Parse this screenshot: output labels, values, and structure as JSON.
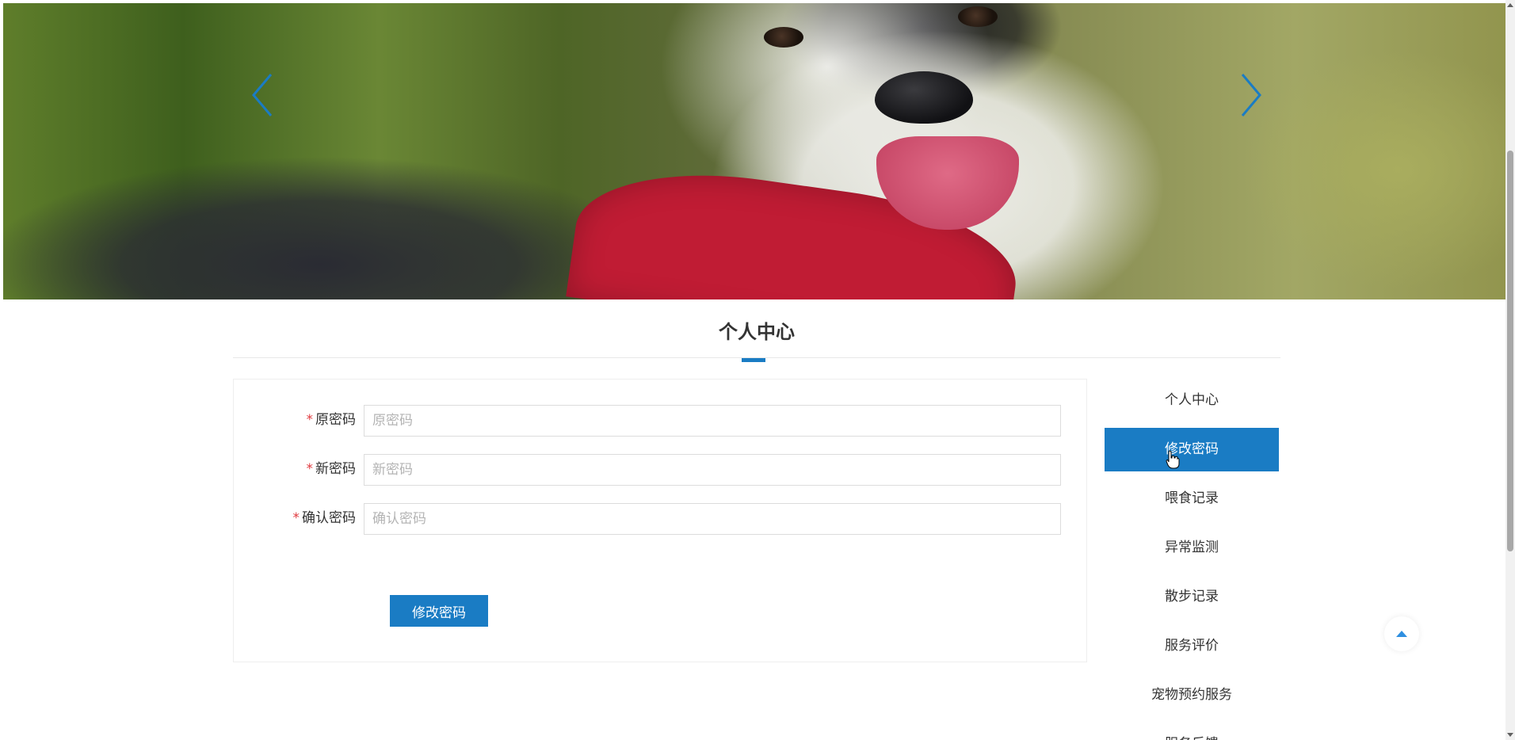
{
  "banner": {
    "prev_icon": "chevron-left-icon",
    "next_icon": "chevron-right-icon",
    "arrow_color": "#1a7cc4"
  },
  "section": {
    "title": "个人中心"
  },
  "form": {
    "fields": [
      {
        "label": "原密码",
        "required": "*",
        "placeholder": "原密码",
        "value": ""
      },
      {
        "label": "新密码",
        "required": "*",
        "placeholder": "新密码",
        "value": ""
      },
      {
        "label": "确认密码",
        "required": "*",
        "placeholder": "确认密码",
        "value": ""
      }
    ],
    "submit_label": "修改密码"
  },
  "side_menu": {
    "items": [
      {
        "label": "个人中心",
        "active": false
      },
      {
        "label": "修改密码",
        "active": true
      },
      {
        "label": "喂食记录",
        "active": false
      },
      {
        "label": "异常监测",
        "active": false
      },
      {
        "label": "散步记录",
        "active": false
      },
      {
        "label": "服务评价",
        "active": false
      },
      {
        "label": "宠物预约服务",
        "active": false
      },
      {
        "label": "服务反馈",
        "active": false
      }
    ]
  },
  "back_top": {
    "icon": "arrow-up-icon"
  },
  "colors": {
    "accent": "#1a7cc4",
    "required": "#e0393e",
    "border": "#dcdcdc"
  }
}
